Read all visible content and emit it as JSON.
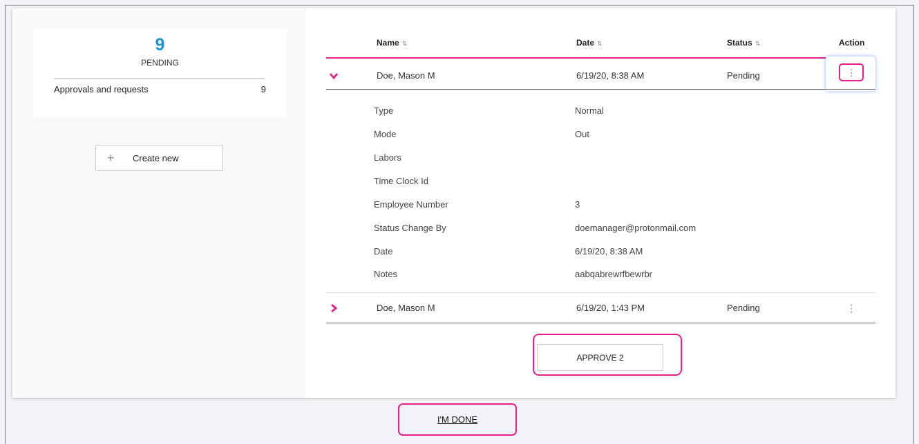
{
  "summary": {
    "count": "9",
    "label": "PENDING",
    "row_label": "Approvals and requests",
    "row_count": "9"
  },
  "create_button": {
    "icon": "plus-icon",
    "label": "Create new"
  },
  "table": {
    "columns": [
      {
        "label": "Name",
        "sort_icon": "⇅"
      },
      {
        "label": "Date",
        "sort_icon": "⇅"
      },
      {
        "label": "Status",
        "sort_icon": "⇅"
      },
      {
        "label": "Action"
      }
    ],
    "rows": [
      {
        "name": "Doe, Mason M",
        "date": "6/19/20, 8:38 AM",
        "status": "Pending",
        "expanded": true
      },
      {
        "name": "Doe, Mason M",
        "date": "6/19/20, 1:43 PM",
        "status": "Pending",
        "expanded": false
      }
    ],
    "details": [
      {
        "label": "Type",
        "value": "Normal"
      },
      {
        "label": "Mode",
        "value": "Out"
      },
      {
        "label": "Labors",
        "value": ""
      },
      {
        "label": "Time Clock Id",
        "value": ""
      },
      {
        "label": "Employee Number",
        "value": "3"
      },
      {
        "label": "Status Change By",
        "value": "doemanager@protonmail.com"
      },
      {
        "label": "Date",
        "value": "6/19/20, 8:38 AM"
      },
      {
        "label": "Notes",
        "value": "aabqabrewrfbewrbr"
      }
    ],
    "kebab": "⋮"
  },
  "approve_button": {
    "label": "APPROVE 2"
  },
  "done_link": {
    "label": "I'M DONE"
  },
  "colors": {
    "accent": "#e91e8c",
    "count_blue": "#1b93d2"
  }
}
